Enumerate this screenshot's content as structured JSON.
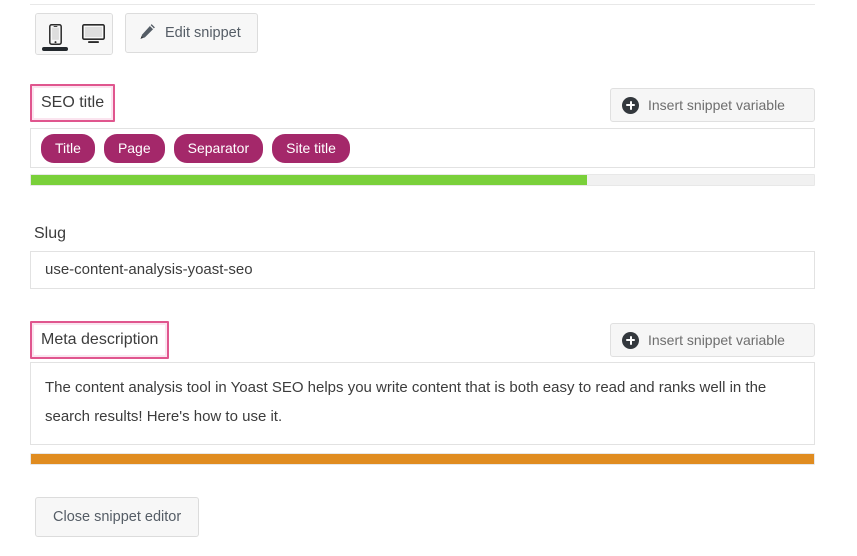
{
  "toolbar": {
    "device_toggle": {
      "mobile_label": "mobile-preview",
      "desktop_label": "desktop-preview",
      "active": "mobile"
    },
    "edit_snippet_label": "Edit snippet",
    "pencil_icon": "pencil-icon"
  },
  "seo_title": {
    "label": "SEO title",
    "insert_variable_label": "Insert snippet variable",
    "plus_icon": "plus-circle-icon",
    "variables": [
      {
        "label": "Title"
      },
      {
        "label": "Page"
      },
      {
        "label": "Separator"
      },
      {
        "label": "Site title"
      }
    ],
    "progress": {
      "percent": 71,
      "color": "#7ad03a",
      "track_color": "#f1f1f1"
    }
  },
  "slug": {
    "label": "Slug",
    "value": "use-content-analysis-yoast-seo"
  },
  "meta_description": {
    "label": "Meta description",
    "insert_variable_label": "Insert snippet variable",
    "plus_icon": "plus-circle-icon",
    "value": "The content analysis tool in Yoast SEO helps you write content that is both easy to read and ranks well in the search results! Here's how to use it.",
    "progress": {
      "percent": 100,
      "color": "#e08c20",
      "track_color": "#f1f1f1"
    }
  },
  "footer": {
    "close_label": "Close snippet editor"
  },
  "colors": {
    "highlight_border": "#e0568e",
    "highlight_glow": "#fbe4ef",
    "chip_background": "#a4286a",
    "good_green": "#7ad03a",
    "warn_orange": "#e08c20"
  }
}
